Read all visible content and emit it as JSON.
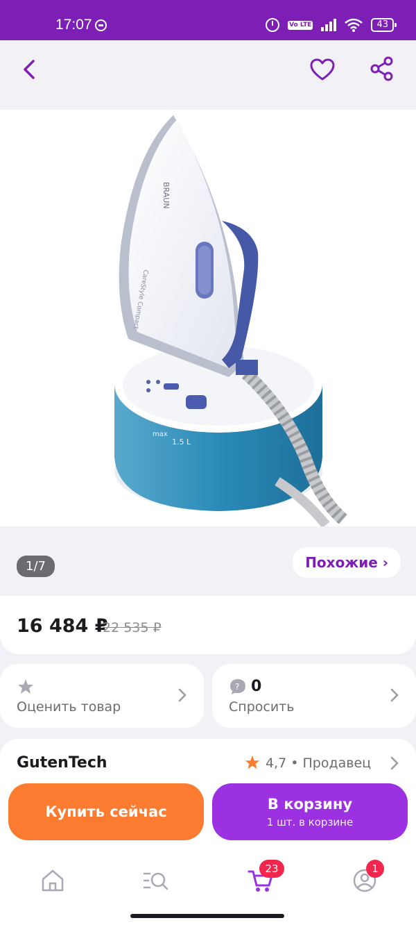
{
  "status_bar": {
    "time": "17:07",
    "volte": "Vo LTE",
    "battery": "43"
  },
  "header": {
    "back_icon": "chevron-left-icon",
    "favorite_icon": "heart-icon",
    "share_icon": "share-icon"
  },
  "gallery": {
    "counter_current": "1",
    "counter_total": "/7",
    "similar_label": "Похожие ›",
    "image": {
      "brand": "BRAUN",
      "model": "CareStyle Compact",
      "scale_max": "max",
      "scale_value": "1.5 L"
    }
  },
  "price": {
    "current": "16 484 ₽",
    "old": "22 535 ₽"
  },
  "rate_card": {
    "label": "Оценить товар",
    "icon": "star-icon"
  },
  "ask_card": {
    "count": "0",
    "label": "Спросить",
    "icon": "question-bubble-icon"
  },
  "seller": {
    "name": "GutenTech",
    "rating": "4,7 • Продавец"
  },
  "actions": {
    "buy_now": "Купить сейчас",
    "add_to_cart": "В корзину",
    "cart_hint": "1 шт. в корзине"
  },
  "bottom_nav": {
    "items": [
      {
        "icon": "home-icon"
      },
      {
        "icon": "catalog-search-icon"
      },
      {
        "icon": "cart-icon",
        "badge": "23"
      },
      {
        "icon": "profile-icon",
        "badge": "1"
      }
    ]
  },
  "colors": {
    "brand_purple": "#7d1fb4",
    "buy_orange": "#fb7c31",
    "cart_purple": "#9b31e0",
    "badge_red": "#f0264d"
  }
}
